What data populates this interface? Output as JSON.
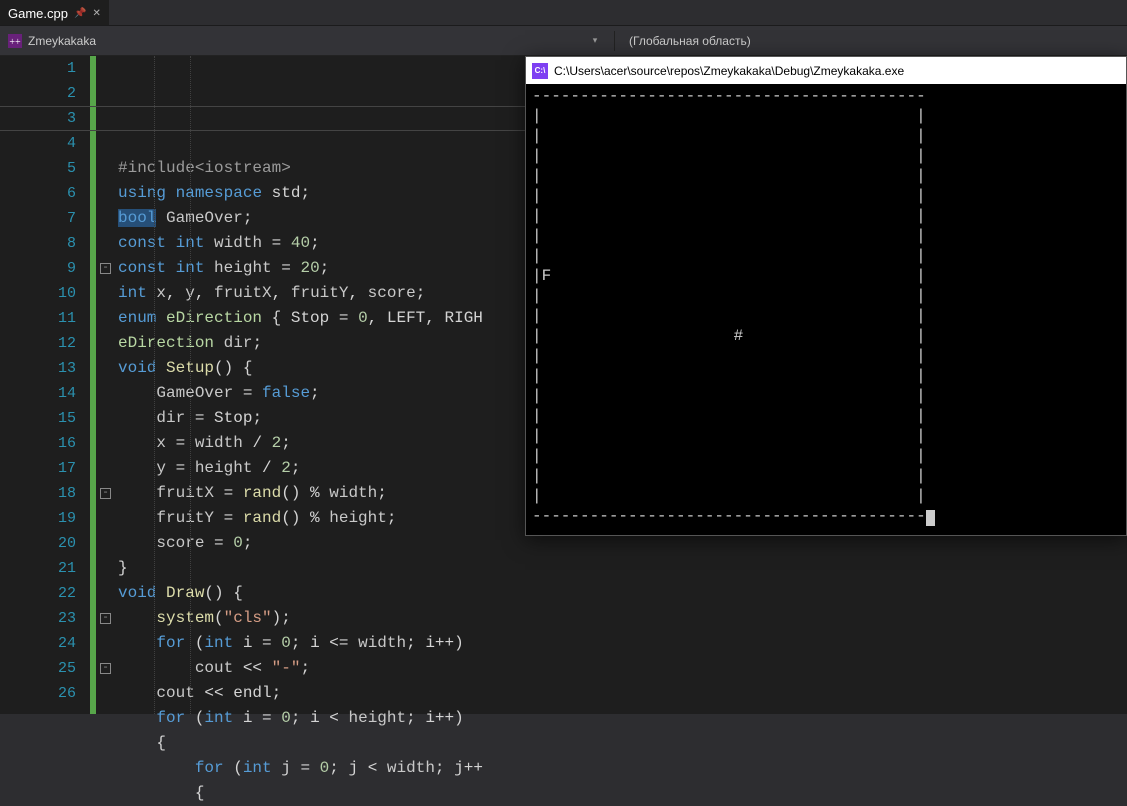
{
  "tab": {
    "filename": "Game.cpp"
  },
  "navbar": {
    "project": "Zmeykakaka",
    "scope": "(Глобальная область)"
  },
  "editor": {
    "current_line": 3,
    "lines": [
      [
        [
          "pp",
          "#include"
        ],
        [
          "pp",
          "<iostream>"
        ]
      ],
      [
        [
          "kw",
          "using"
        ],
        [
          "punc",
          " "
        ],
        [
          "kw",
          "namespace"
        ],
        [
          "punc",
          " "
        ],
        [
          "id",
          "std"
        ],
        [
          "punc",
          ";"
        ]
      ],
      [
        [
          "kw",
          "bool"
        ],
        [
          "punc",
          " "
        ],
        [
          "glob",
          "GameOver"
        ],
        [
          "punc",
          ";"
        ]
      ],
      [
        [
          "kw",
          "const"
        ],
        [
          "punc",
          " "
        ],
        [
          "kw",
          "int"
        ],
        [
          "punc",
          " "
        ],
        [
          "glob",
          "width"
        ],
        [
          "punc",
          " = "
        ],
        [
          "num",
          "40"
        ],
        [
          "punc",
          ";"
        ]
      ],
      [
        [
          "kw",
          "const"
        ],
        [
          "punc",
          " "
        ],
        [
          "kw",
          "int"
        ],
        [
          "punc",
          " "
        ],
        [
          "glob",
          "height"
        ],
        [
          "punc",
          " = "
        ],
        [
          "num",
          "20"
        ],
        [
          "punc",
          ";"
        ]
      ],
      [
        [
          "kw",
          "int"
        ],
        [
          "punc",
          " "
        ],
        [
          "glob",
          "x"
        ],
        [
          "punc",
          ", "
        ],
        [
          "glob",
          "y"
        ],
        [
          "punc",
          ", "
        ],
        [
          "glob",
          "fruitX"
        ],
        [
          "punc",
          ", "
        ],
        [
          "glob",
          "fruitY"
        ],
        [
          "punc",
          ", "
        ],
        [
          "glob",
          "score"
        ],
        [
          "punc",
          ";"
        ]
      ],
      [
        [
          "kw",
          "enum"
        ],
        [
          "punc",
          " "
        ],
        [
          "enum",
          "eDirection"
        ],
        [
          "punc",
          " { "
        ],
        [
          "id",
          "Stop"
        ],
        [
          "punc",
          " = "
        ],
        [
          "num",
          "0"
        ],
        [
          "punc",
          ", "
        ],
        [
          "id",
          "LEFT"
        ],
        [
          "punc",
          ", "
        ],
        [
          "id",
          "RIGH"
        ]
      ],
      [
        [
          "enum",
          "eDirection"
        ],
        [
          "punc",
          " "
        ],
        [
          "glob",
          "dir"
        ],
        [
          "punc",
          ";"
        ]
      ],
      [
        [
          "kw",
          "void"
        ],
        [
          "punc",
          " "
        ],
        [
          "func",
          "Setup"
        ],
        [
          "punc",
          "() {"
        ]
      ],
      [
        [
          "punc",
          "    "
        ],
        [
          "glob",
          "GameOver"
        ],
        [
          "punc",
          " = "
        ],
        [
          "kw",
          "false"
        ],
        [
          "punc",
          ";"
        ]
      ],
      [
        [
          "punc",
          "    "
        ],
        [
          "glob",
          "dir"
        ],
        [
          "punc",
          " = "
        ],
        [
          "id",
          "Stop"
        ],
        [
          "punc",
          ";"
        ]
      ],
      [
        [
          "punc",
          "    "
        ],
        [
          "glob",
          "x"
        ],
        [
          "punc",
          " = "
        ],
        [
          "glob",
          "width"
        ],
        [
          "punc",
          " / "
        ],
        [
          "num",
          "2"
        ],
        [
          "punc",
          ";"
        ]
      ],
      [
        [
          "punc",
          "    "
        ],
        [
          "glob",
          "y"
        ],
        [
          "punc",
          " = "
        ],
        [
          "glob",
          "height"
        ],
        [
          "punc",
          " / "
        ],
        [
          "num",
          "2"
        ],
        [
          "punc",
          ";"
        ]
      ],
      [
        [
          "punc",
          "    "
        ],
        [
          "glob",
          "fruitX"
        ],
        [
          "punc",
          " = "
        ],
        [
          "func",
          "rand"
        ],
        [
          "punc",
          "() % "
        ],
        [
          "glob",
          "width"
        ],
        [
          "punc",
          ";"
        ]
      ],
      [
        [
          "punc",
          "    "
        ],
        [
          "glob",
          "fruitY"
        ],
        [
          "punc",
          " = "
        ],
        [
          "func",
          "rand"
        ],
        [
          "punc",
          "() % "
        ],
        [
          "glob",
          "height"
        ],
        [
          "punc",
          ";"
        ]
      ],
      [
        [
          "punc",
          "    "
        ],
        [
          "glob",
          "score"
        ],
        [
          "punc",
          " = "
        ],
        [
          "num",
          "0"
        ],
        [
          "punc",
          ";"
        ]
      ],
      [
        [
          "punc",
          "}"
        ]
      ],
      [
        [
          "kw",
          "void"
        ],
        [
          "punc",
          " "
        ],
        [
          "func",
          "Draw"
        ],
        [
          "punc",
          "() {"
        ]
      ],
      [
        [
          "punc",
          "    "
        ],
        [
          "func",
          "system"
        ],
        [
          "punc",
          "("
        ],
        [
          "str",
          "\"cls\""
        ],
        [
          "punc",
          ");"
        ]
      ],
      [
        [
          "punc",
          "    "
        ],
        [
          "kw",
          "for"
        ],
        [
          "punc",
          " ("
        ],
        [
          "kw",
          "int"
        ],
        [
          "punc",
          " "
        ],
        [
          "id",
          "i"
        ],
        [
          "punc",
          " = "
        ],
        [
          "num",
          "0"
        ],
        [
          "punc",
          "; "
        ],
        [
          "id",
          "i"
        ],
        [
          "punc",
          " <= "
        ],
        [
          "glob",
          "width"
        ],
        [
          "punc",
          "; "
        ],
        [
          "id",
          "i"
        ],
        [
          "punc",
          "++)"
        ]
      ],
      [
        [
          "punc",
          "        "
        ],
        [
          "glob",
          "cout"
        ],
        [
          "punc",
          " << "
        ],
        [
          "str",
          "\"-\""
        ],
        [
          "punc",
          ";"
        ]
      ],
      [
        [
          "punc",
          "    "
        ],
        [
          "glob",
          "cout"
        ],
        [
          "punc",
          " << "
        ],
        [
          "id",
          "endl"
        ],
        [
          "punc",
          ";"
        ]
      ],
      [
        [
          "punc",
          "    "
        ],
        [
          "kw",
          "for"
        ],
        [
          "punc",
          " ("
        ],
        [
          "kw",
          "int"
        ],
        [
          "punc",
          " "
        ],
        [
          "id",
          "i"
        ],
        [
          "punc",
          " = "
        ],
        [
          "num",
          "0"
        ],
        [
          "punc",
          "; "
        ],
        [
          "id",
          "i"
        ],
        [
          "punc",
          " < "
        ],
        [
          "glob",
          "height"
        ],
        [
          "punc",
          "; "
        ],
        [
          "id",
          "i"
        ],
        [
          "punc",
          "++)"
        ]
      ],
      [
        [
          "punc",
          "    {"
        ]
      ],
      [
        [
          "punc",
          "        "
        ],
        [
          "kw",
          "for"
        ],
        [
          "punc",
          " ("
        ],
        [
          "kw",
          "int"
        ],
        [
          "punc",
          " "
        ],
        [
          "id",
          "j"
        ],
        [
          "punc",
          " = "
        ],
        [
          "num",
          "0"
        ],
        [
          "punc",
          "; "
        ],
        [
          "id",
          "j"
        ],
        [
          "punc",
          " < "
        ],
        [
          "glob",
          "width"
        ],
        [
          "punc",
          "; "
        ],
        [
          "id",
          "j"
        ],
        [
          "punc",
          "++"
        ]
      ],
      [
        [
          "punc",
          "        {"
        ]
      ]
    ],
    "folds": [
      {
        "line": 9,
        "glyph": "-"
      },
      {
        "line": 18,
        "glyph": "-"
      },
      {
        "line": 23,
        "glyph": "-"
      },
      {
        "line": 25,
        "glyph": "-"
      }
    ]
  },
  "console": {
    "title": "C:\\Users\\acer\\source\\repos\\Zmeykakaka\\Debug\\Zmeykakaka.exe",
    "rows": 22,
    "cols": 41,
    "fruit": {
      "row": 9,
      "col": 1,
      "char": "F"
    },
    "head": {
      "row": 12,
      "col": 21,
      "char": "#"
    }
  }
}
